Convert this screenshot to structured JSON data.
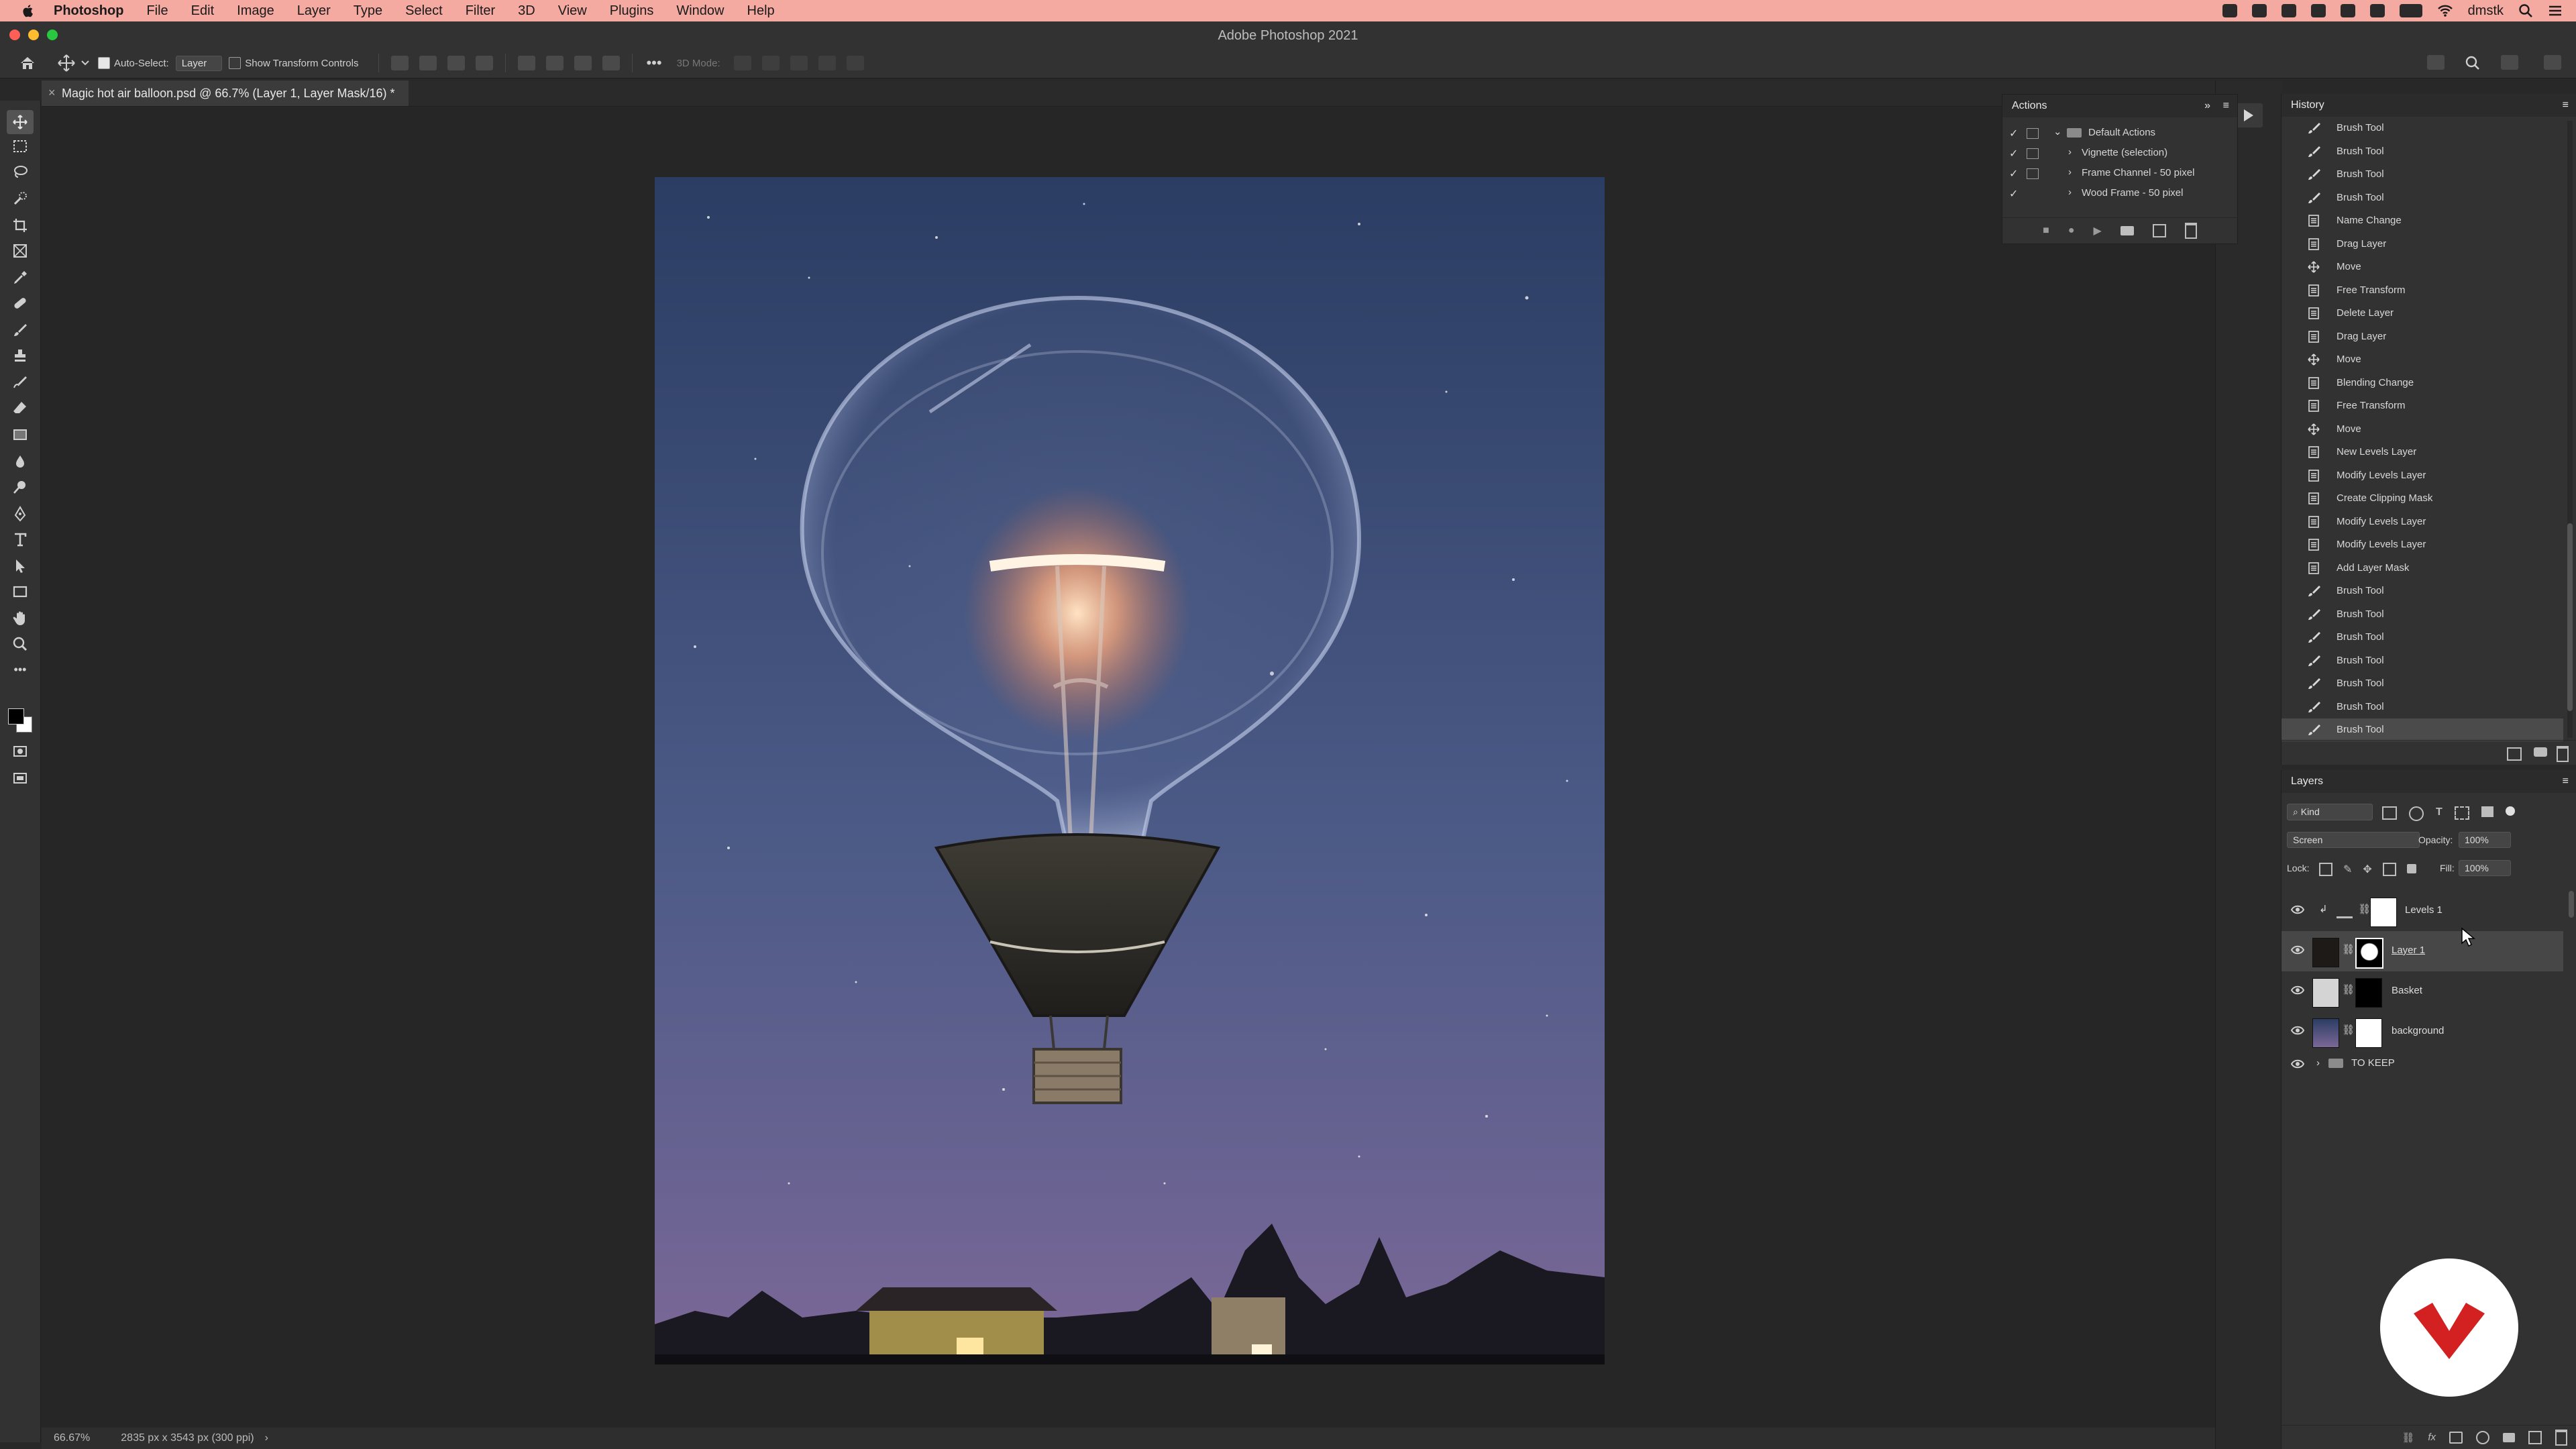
{
  "menubar": {
    "app": "Photoshop",
    "items": [
      "File",
      "Edit",
      "Image",
      "Layer",
      "Type",
      "Select",
      "Filter",
      "3D",
      "View",
      "Plugins",
      "Window",
      "Help"
    ],
    "user": "dmstk"
  },
  "window": {
    "title": "Adobe Photoshop 2021"
  },
  "options_bar": {
    "auto_select_label": "Auto-Select:",
    "auto_select_value": "Layer",
    "show_transform_label": "Show Transform Controls",
    "mode_3d_label": "3D Mode:"
  },
  "document_tab": {
    "label": "Magic hot air balloon.psd @ 66.7% (Layer 1, Layer Mask/16) *"
  },
  "status_bar": {
    "zoom": "66.67%",
    "doc_info": "2835 px x 3543 px (300 ppi)"
  },
  "actions_panel": {
    "title": "Actions",
    "rows": [
      {
        "label": "Default Actions",
        "type": "set"
      },
      {
        "label": "Vignette (selection)",
        "type": "action"
      },
      {
        "label": "Frame Channel - 50 pixel",
        "type": "action"
      },
      {
        "label": "Wood Frame - 50 pixel",
        "type": "action"
      }
    ]
  },
  "history_panel": {
    "title": "History",
    "items": [
      {
        "label": "Brush Tool",
        "icon": "brush-icon"
      },
      {
        "label": "Brush Tool",
        "icon": "brush-icon"
      },
      {
        "label": "Brush Tool",
        "icon": "brush-icon"
      },
      {
        "label": "Brush Tool",
        "icon": "brush-icon"
      },
      {
        "label": "Name Change",
        "icon": "document-icon"
      },
      {
        "label": "Drag Layer",
        "icon": "document-icon"
      },
      {
        "label": "Move",
        "icon": "move-icon"
      },
      {
        "label": "Free Transform",
        "icon": "document-icon"
      },
      {
        "label": "Delete Layer",
        "icon": "document-icon"
      },
      {
        "label": "Drag Layer",
        "icon": "document-icon"
      },
      {
        "label": "Move",
        "icon": "move-icon"
      },
      {
        "label": "Blending Change",
        "icon": "document-icon"
      },
      {
        "label": "Free Transform",
        "icon": "document-icon"
      },
      {
        "label": "Move",
        "icon": "move-icon"
      },
      {
        "label": "New Levels Layer",
        "icon": "document-icon"
      },
      {
        "label": "Modify Levels Layer",
        "icon": "document-icon"
      },
      {
        "label": "Create Clipping Mask",
        "icon": "document-icon"
      },
      {
        "label": "Modify Levels Layer",
        "icon": "document-icon"
      },
      {
        "label": "Modify Levels Layer",
        "icon": "document-icon"
      },
      {
        "label": "Add Layer Mask",
        "icon": "document-icon"
      },
      {
        "label": "Brush Tool",
        "icon": "brush-icon"
      },
      {
        "label": "Brush Tool",
        "icon": "brush-icon"
      },
      {
        "label": "Brush Tool",
        "icon": "brush-icon"
      },
      {
        "label": "Brush Tool",
        "icon": "brush-icon"
      },
      {
        "label": "Brush Tool",
        "icon": "brush-icon"
      },
      {
        "label": "Brush Tool",
        "icon": "brush-icon"
      },
      {
        "label": "Brush Tool",
        "icon": "brush-icon"
      }
    ],
    "active_index": 26
  },
  "layers_panel": {
    "title": "Layers",
    "filter_kind": "Kind",
    "blend_mode": "Screen",
    "opacity_label": "Opacity:",
    "opacity_value": "100%",
    "lock_label": "Lock:",
    "fill_label": "Fill:",
    "fill_value": "100%",
    "layers": [
      {
        "name": "Levels 1",
        "type": "adjustment"
      },
      {
        "name": "Layer 1",
        "type": "masked",
        "selected": true
      },
      {
        "name": "Basket",
        "type": "masked"
      },
      {
        "name": "background",
        "type": "masked"
      },
      {
        "name": "TO KEEP",
        "type": "group"
      }
    ]
  },
  "colors": {
    "accent": "#d32020",
    "menubar": "#f4a9a1",
    "panel": "#323232"
  }
}
